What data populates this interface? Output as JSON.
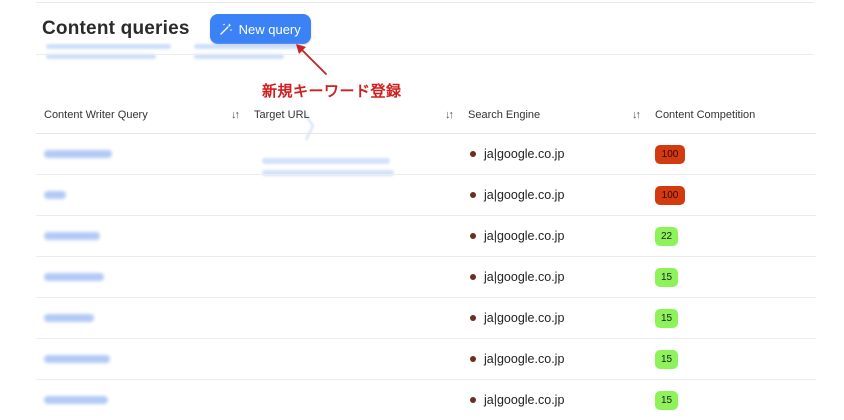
{
  "header": {
    "title": "Content queries",
    "new_query_label": "New query"
  },
  "annotation": {
    "text": "新規キーワード登録",
    "color": "#d02020"
  },
  "colors": {
    "accent": "#3b82f6",
    "high_competition": "#d33a10",
    "low_competition": "#8ef25a"
  },
  "table": {
    "columns": [
      {
        "label": "Content Writer Query",
        "sortable": true
      },
      {
        "label": "Target URL",
        "sortable": true
      },
      {
        "label": "Search Engine",
        "sortable": true
      },
      {
        "label": "Content Competition",
        "sortable": false
      }
    ],
    "sort_icon": "sort-arrows-icon",
    "rows": [
      {
        "engine": "ja|google.co.jp",
        "competition": "100",
        "level": "high"
      },
      {
        "engine": "ja|google.co.jp",
        "competition": "100",
        "level": "high"
      },
      {
        "engine": "ja|google.co.jp",
        "competition": "22",
        "level": "low"
      },
      {
        "engine": "ja|google.co.jp",
        "competition": "15",
        "level": "low"
      },
      {
        "engine": "ja|google.co.jp",
        "competition": "15",
        "level": "low"
      },
      {
        "engine": "ja|google.co.jp",
        "competition": "15",
        "level": "low"
      },
      {
        "engine": "ja|google.co.jp",
        "competition": "15",
        "level": "low"
      }
    ]
  }
}
